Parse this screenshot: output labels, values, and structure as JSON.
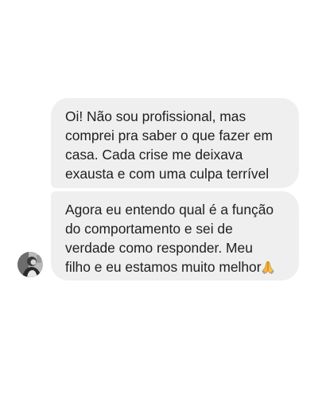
{
  "messages": [
    {
      "lines": [
        "Oi! Não sou profissional, mas",
        "comprei pra saber o que fazer em",
        "casa. Cada crise me deixava",
        "exausta e com uma culpa terrível"
      ]
    },
    {
      "lines": [
        "Agora eu entendo qual é a função",
        "do comportamento e sei de",
        "verdade como responder. Meu",
        "filho e eu estamos muito melhor"
      ],
      "trailing_icon": "folded-hands-emoji"
    }
  ],
  "colors": {
    "background": "#ffffff",
    "bubble": "#efefef",
    "text": "#1f1f1f"
  }
}
